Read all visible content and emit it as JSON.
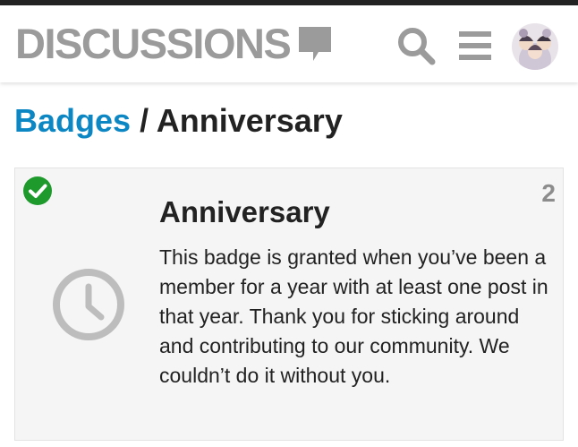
{
  "header": {
    "logo_text": "DISCUSSIONS",
    "icons": {
      "logo": "speech-bubble-icon",
      "search": "search-icon",
      "menu": "hamburger-menu-icon",
      "avatar": "user-avatar"
    }
  },
  "breadcrumb": {
    "parent": "Badges",
    "separator": "/",
    "current": "Anniversary"
  },
  "badge": {
    "granted_icon": "check-circle-icon",
    "count": "2",
    "icon": "clock-icon",
    "title": "Anniversary",
    "description": "This badge is granted when you’ve been a member for a year with at least one post in that year. Thank you for sticking around and contributing to our community. We couldn’t do it without you."
  },
  "colors": {
    "link": "#0c87c4",
    "granted": "#1e9a2d",
    "muted": "#9b9b9b",
    "text": "#222222",
    "card_bg": "#f5f5f5"
  }
}
